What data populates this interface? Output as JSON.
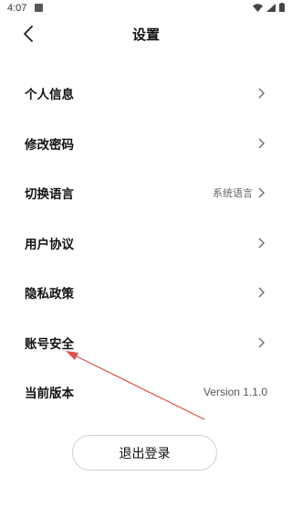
{
  "status_bar": {
    "time": "4:07"
  },
  "header": {
    "title": "设置"
  },
  "settings": {
    "items": [
      {
        "label": "个人信息",
        "value": ""
      },
      {
        "label": "修改密码",
        "value": ""
      },
      {
        "label": "切换语言",
        "value": "系统语言"
      },
      {
        "label": "用户协议",
        "value": ""
      },
      {
        "label": "隐私政策",
        "value": ""
      },
      {
        "label": "账号安全",
        "value": ""
      },
      {
        "label": "当前版本",
        "value": "Version 1.1.0"
      }
    ]
  },
  "logout": {
    "label": "退出登录"
  },
  "colors": {
    "annotation": "#d9534f"
  }
}
